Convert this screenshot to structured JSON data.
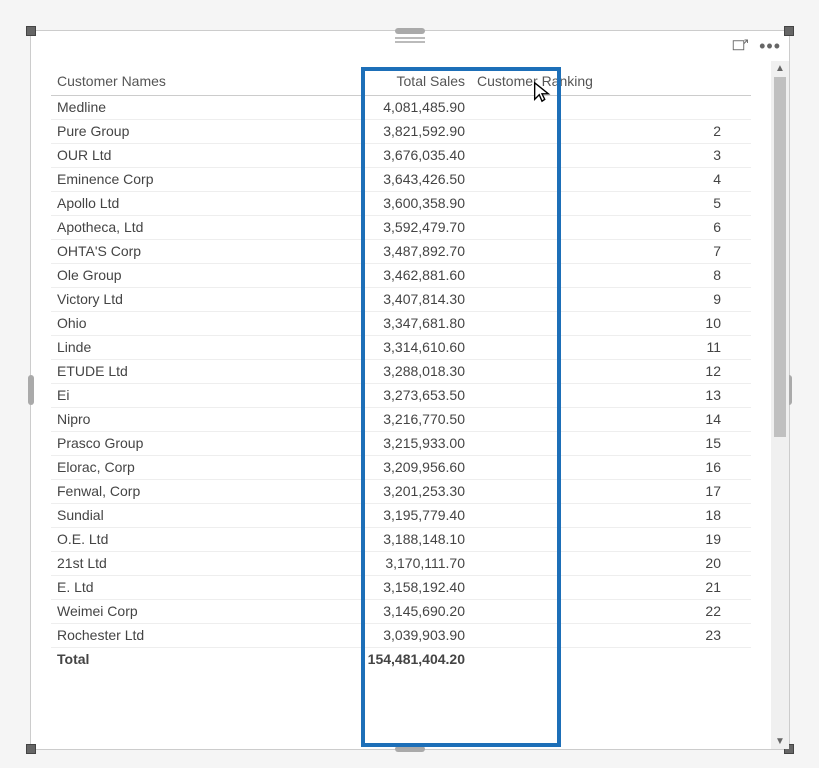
{
  "columns": {
    "name": "Customer Names",
    "sales": "Total Sales",
    "rank": "Customer Ranking"
  },
  "rows": [
    {
      "name": "Medline",
      "sales": "4,081,485.90",
      "rank": ""
    },
    {
      "name": "Pure Group",
      "sales": "3,821,592.90",
      "rank": "2"
    },
    {
      "name": "OUR Ltd",
      "sales": "3,676,035.40",
      "rank": "3"
    },
    {
      "name": "Eminence Corp",
      "sales": "3,643,426.50",
      "rank": "4"
    },
    {
      "name": "Apollo Ltd",
      "sales": "3,600,358.90",
      "rank": "5"
    },
    {
      "name": "Apotheca, Ltd",
      "sales": "3,592,479.70",
      "rank": "6"
    },
    {
      "name": "OHTA'S Corp",
      "sales": "3,487,892.70",
      "rank": "7"
    },
    {
      "name": "Ole Group",
      "sales": "3,462,881.60",
      "rank": "8"
    },
    {
      "name": "Victory Ltd",
      "sales": "3,407,814.30",
      "rank": "9"
    },
    {
      "name": "Ohio",
      "sales": "3,347,681.80",
      "rank": "10"
    },
    {
      "name": "Linde",
      "sales": "3,314,610.60",
      "rank": "11"
    },
    {
      "name": "ETUDE Ltd",
      "sales": "3,288,018.30",
      "rank": "12"
    },
    {
      "name": "Ei",
      "sales": "3,273,653.50",
      "rank": "13"
    },
    {
      "name": "Nipro",
      "sales": "3,216,770.50",
      "rank": "14"
    },
    {
      "name": "Prasco Group",
      "sales": "3,215,933.00",
      "rank": "15"
    },
    {
      "name": "Elorac, Corp",
      "sales": "3,209,956.60",
      "rank": "16"
    },
    {
      "name": "Fenwal, Corp",
      "sales": "3,201,253.30",
      "rank": "17"
    },
    {
      "name": "Sundial",
      "sales": "3,195,779.40",
      "rank": "18"
    },
    {
      "name": "O.E. Ltd",
      "sales": "3,188,148.10",
      "rank": "19"
    },
    {
      "name": "21st Ltd",
      "sales": "3,170,111.70",
      "rank": "20"
    },
    {
      "name": "E. Ltd",
      "sales": "3,158,192.40",
      "rank": "21"
    },
    {
      "name": "Weimei Corp",
      "sales": "3,145,690.20",
      "rank": "22"
    },
    {
      "name": "Rochester Ltd",
      "sales": "3,039,903.90",
      "rank": "23"
    }
  ],
  "total": {
    "label": "Total",
    "sales": "154,481,404.20",
    "rank": ""
  }
}
